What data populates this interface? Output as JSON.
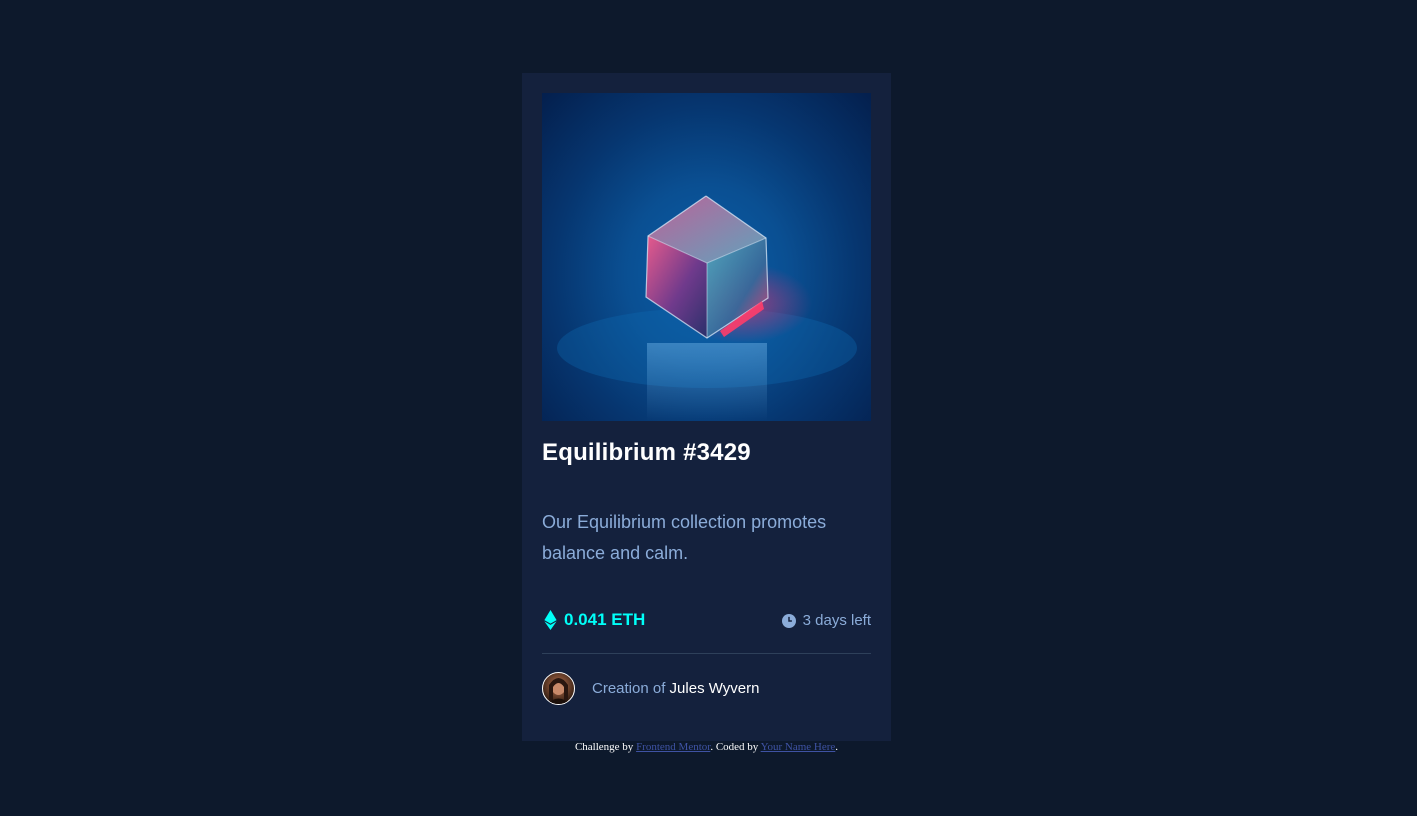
{
  "card": {
    "image_alt": "equilibrium-crystal-image",
    "title": "Equilibrium #3429",
    "description": "Our Equilibrium collection promotes balance and calm.",
    "price": "0.041 ETH",
    "time_left": "3 days left",
    "creator_prefix": "Creation of",
    "creator_name": "Jules Wyvern"
  },
  "attribution": {
    "prefix": "Challenge by",
    "challenge_link": "Frontend Mentor",
    "middle": ". Coded by",
    "author_link": "Your Name Here",
    "suffix": "."
  },
  "icons": {
    "ethereum": "ethereum-icon",
    "clock": "clock-icon"
  },
  "colors": {
    "page_background": "#0d192c",
    "card_background": "#14213d",
    "accent_cyan": "#00fff8",
    "soft_blue": "#8bacd9",
    "white": "#ffffff",
    "link": "#3e52a3"
  }
}
